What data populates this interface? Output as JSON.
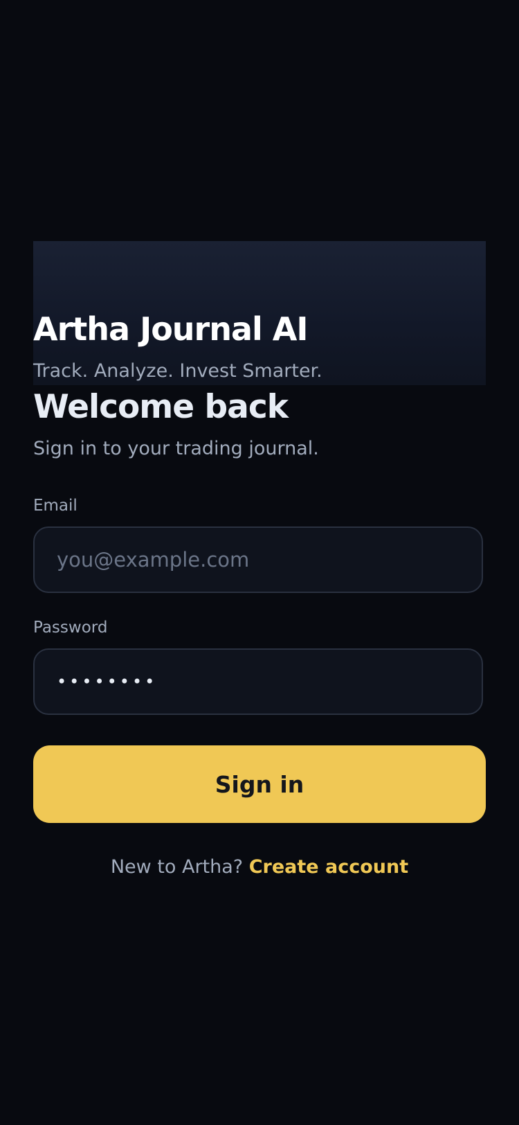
{
  "app": {
    "title": "Artha Journal AI",
    "tagline": "Track. Analyze. Invest Smarter."
  },
  "login": {
    "heading": "Welcome back",
    "subheading": "Sign in to your trading journal.",
    "email": {
      "label": "Email",
      "placeholder": "you@example.com",
      "value": ""
    },
    "password": {
      "label": "Password",
      "placeholder": "",
      "value": "••••••••"
    },
    "submit_label": "Sign in",
    "signup_prompt": "New to Artha?",
    "signup_link": "Create account"
  },
  "colors": {
    "background": "#080a10",
    "accent": "#f0c855",
    "input_bg": "#0f131d",
    "input_border": "#2a3140",
    "muted_text": "#a2acbd"
  }
}
